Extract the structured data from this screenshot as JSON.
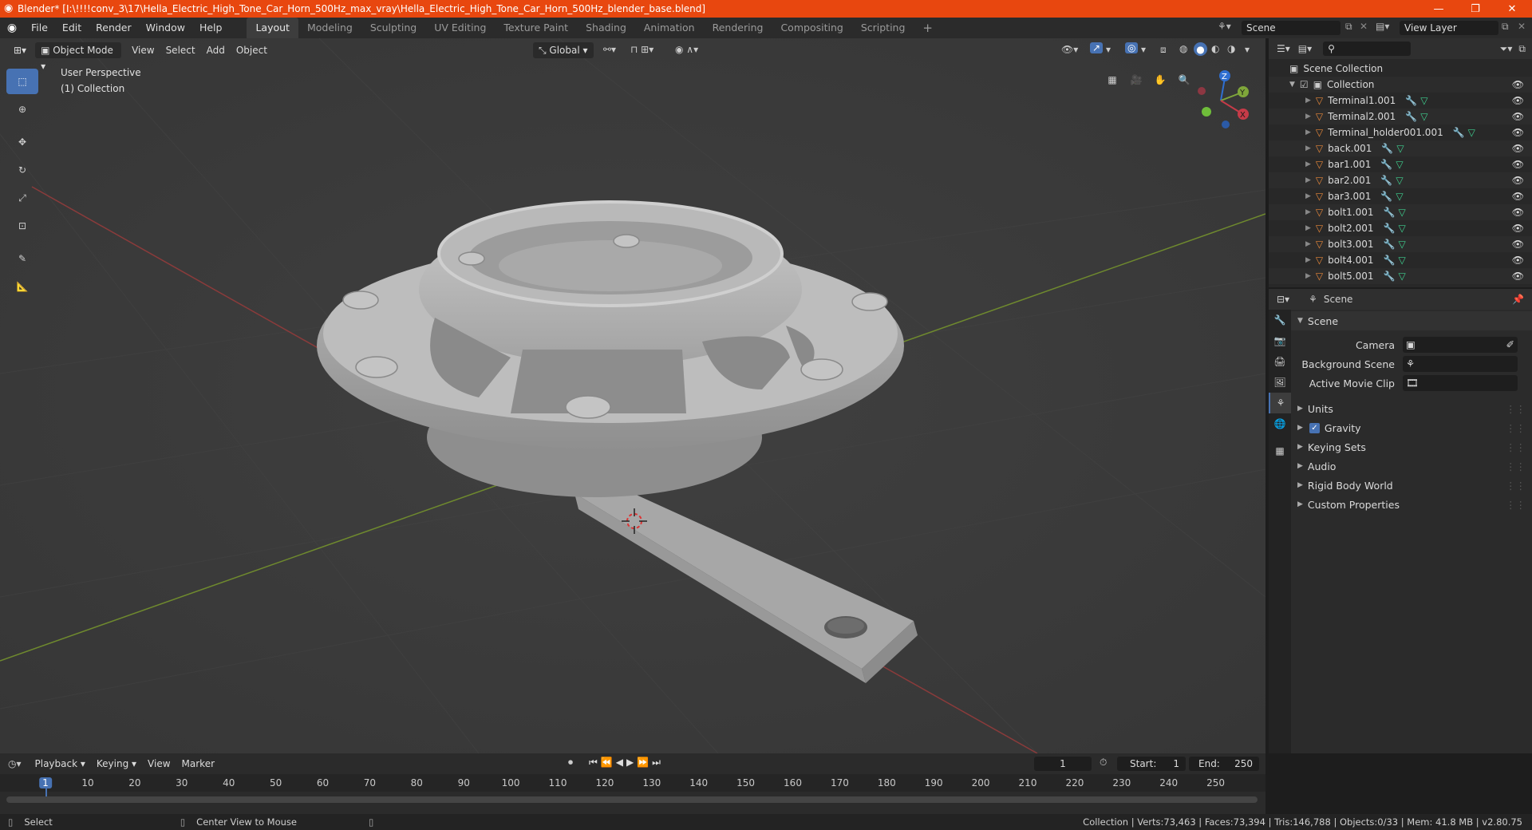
{
  "title_bar": {
    "title": "Blender* [I:\\!!!!conv_3\\17\\Hella_Electric_High_Tone_Car_Horn_500Hz_max_vray\\Hella_Electric_High_Tone_Car_Horn_500Hz_blender_base.blend]"
  },
  "menu": [
    "File",
    "Edit",
    "Render",
    "Window",
    "Help"
  ],
  "workspaces": [
    "Layout",
    "Modeling",
    "Sculpting",
    "UV Editing",
    "Texture Paint",
    "Shading",
    "Animation",
    "Rendering",
    "Compositing",
    "Scripting"
  ],
  "active_workspace": "Layout",
  "scene_field": "Scene",
  "view_layer_field": "View Layer",
  "viewport": {
    "mode": "Object Mode",
    "menus": [
      "View",
      "Select",
      "Add",
      "Object"
    ],
    "transform_orientation": "Global",
    "overlay_title": "User Perspective",
    "overlay_collection": "(1) Collection",
    "gizmo_axes": [
      "Z",
      "Y",
      "X"
    ]
  },
  "outliner": {
    "root": "Scene Collection",
    "collection": "Collection",
    "items": [
      "Terminal1.001",
      "Terminal2.001",
      "Terminal_holder001.001",
      "back.001",
      "bar1.001",
      "bar2.001",
      "bar3.001",
      "bolt1.001",
      "bolt2.001",
      "bolt3.001",
      "bolt4.001",
      "bolt5.001"
    ]
  },
  "properties": {
    "header": "Scene",
    "panel": "Scene",
    "fields": [
      {
        "label": "Camera"
      },
      {
        "label": "Background Scene"
      },
      {
        "label": "Active Movie Clip"
      }
    ],
    "sections": [
      "Units",
      "Gravity",
      "Keying Sets",
      "Audio",
      "Rigid Body World",
      "Custom Properties"
    ],
    "gravity_checked": true
  },
  "timeline": {
    "menus": [
      "Playback",
      "Keying",
      "View",
      "Marker"
    ],
    "current_frame": "1",
    "start_label": "Start:",
    "start": "1",
    "end_label": "End:",
    "end": "250",
    "ticks": [
      "1",
      "10",
      "20",
      "30",
      "40",
      "50",
      "60",
      "70",
      "80",
      "90",
      "100",
      "110",
      "120",
      "130",
      "140",
      "150",
      "160",
      "170",
      "180",
      "190",
      "200",
      "210",
      "220",
      "230",
      "240",
      "250"
    ]
  },
  "status_bar": {
    "left_action": "Select",
    "middle_action": "Center View to Mouse",
    "stats": "Collection | Verts:73,463 | Faces:73,394 | Tris:146,788 | Objects:0/33 | Mem: 41.8 MB | v2.80.75"
  },
  "colors": {
    "accent": "#4772b3",
    "title_bar": "#e8470f",
    "mesh_icon": "#e8883a",
    "modifier_icon": "#7aa9e6",
    "data_icon": "#3fd08f"
  }
}
